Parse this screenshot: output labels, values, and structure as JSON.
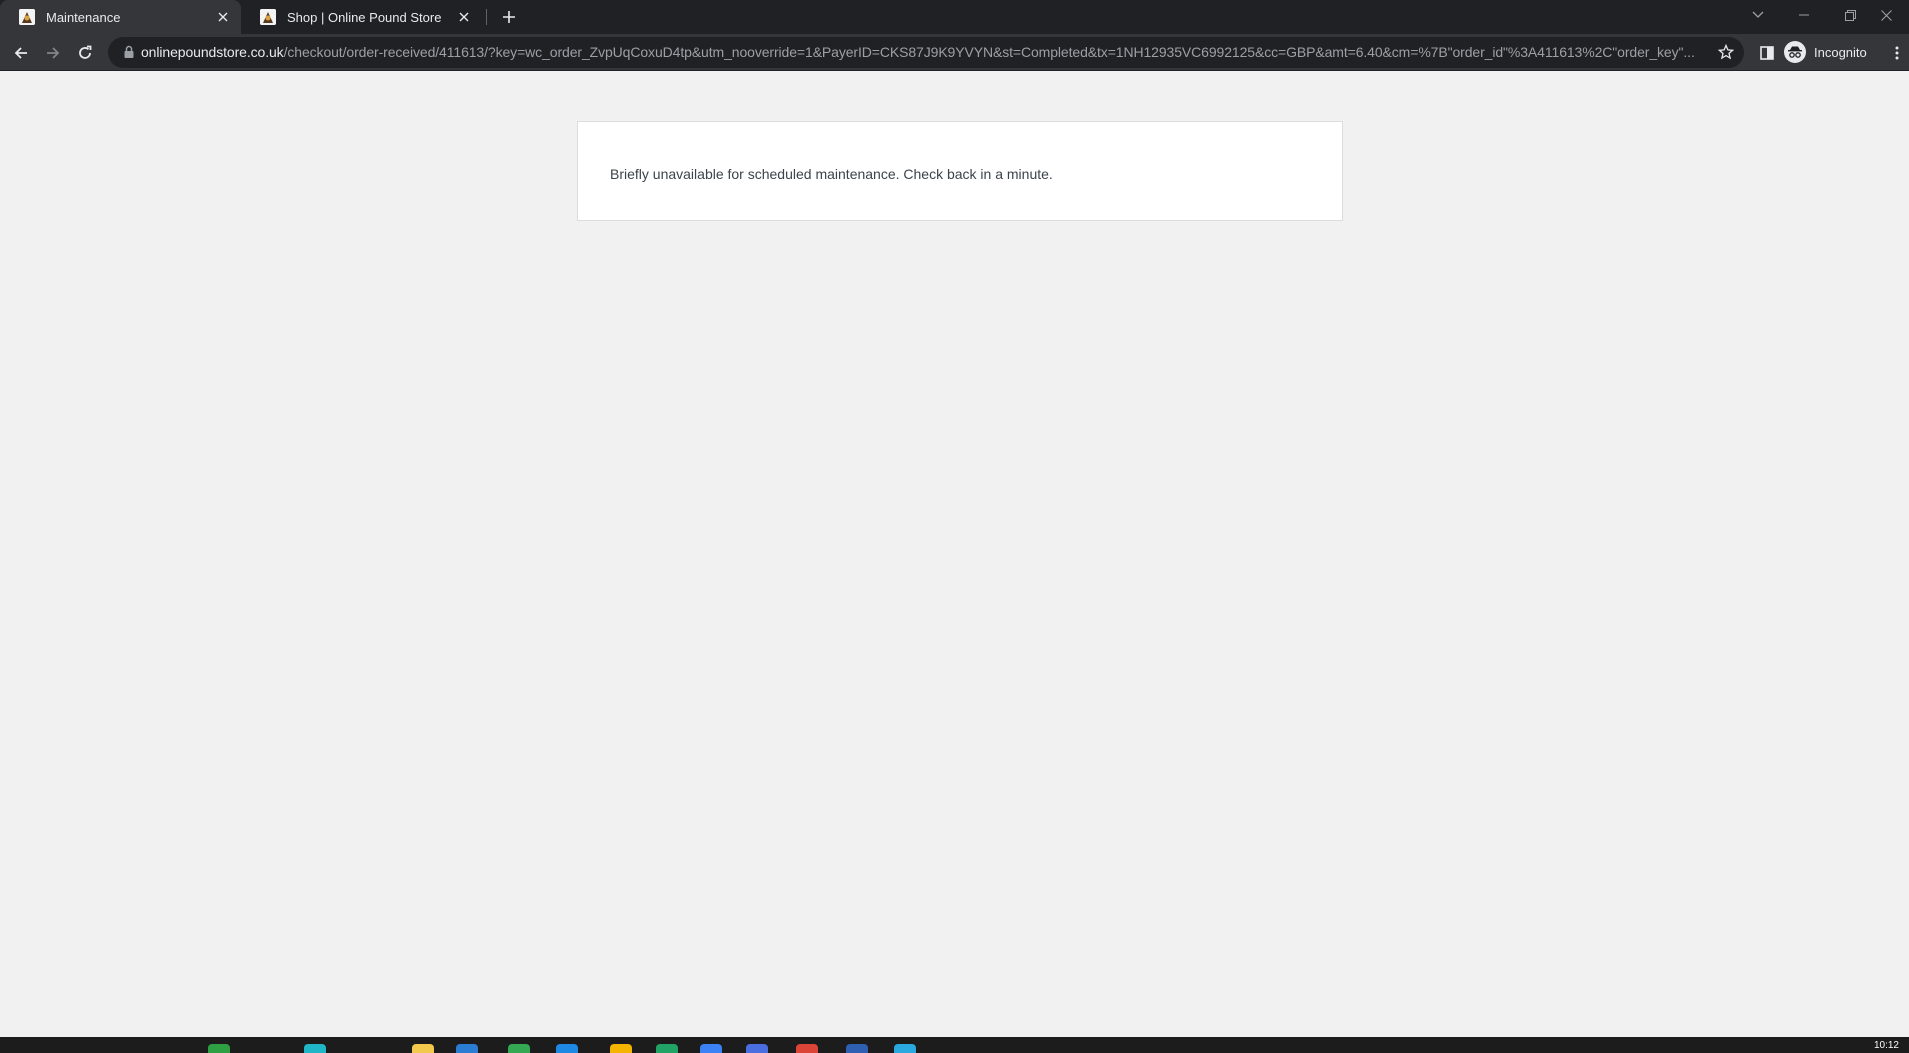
{
  "tabs": [
    {
      "title": "Maintenance",
      "active": true
    },
    {
      "title": "Shop | Online Pound Store",
      "active": false
    }
  ],
  "address_bar": {
    "host": "onlinepoundstore.co.uk",
    "path": "/checkout/order-received/411613/?key=wc_order_ZvpUqCoxuD4tp&utm_nooverride=1&PayerID=CKS87J9K9YVYN&st=Completed&tx=1NH12935VC6992125&cc=GBP&amt=6.40&cm=%7B\"order_id\"%3A411613%2C\"order_key\"..."
  },
  "profile": {
    "label": "Incognito"
  },
  "page": {
    "message": "Briefly unavailable for scheduled maintenance. Check back in a minute."
  },
  "taskbar": {
    "clock": "10:12"
  },
  "colors": {
    "tabstrip": "#202124",
    "toolbar": "#35363a",
    "page_background": "#f1f1f1",
    "notice_background": "#ffffff",
    "notice_text": "#3c434a"
  },
  "icons": {
    "back": "arrow-left-icon",
    "forward": "arrow-right-icon",
    "reload": "reload-icon",
    "lock": "lock-icon",
    "bookmark": "star-icon",
    "side_panel": "side-panel-icon",
    "incognito": "incognito-icon",
    "menu": "kebab-menu-icon"
  }
}
